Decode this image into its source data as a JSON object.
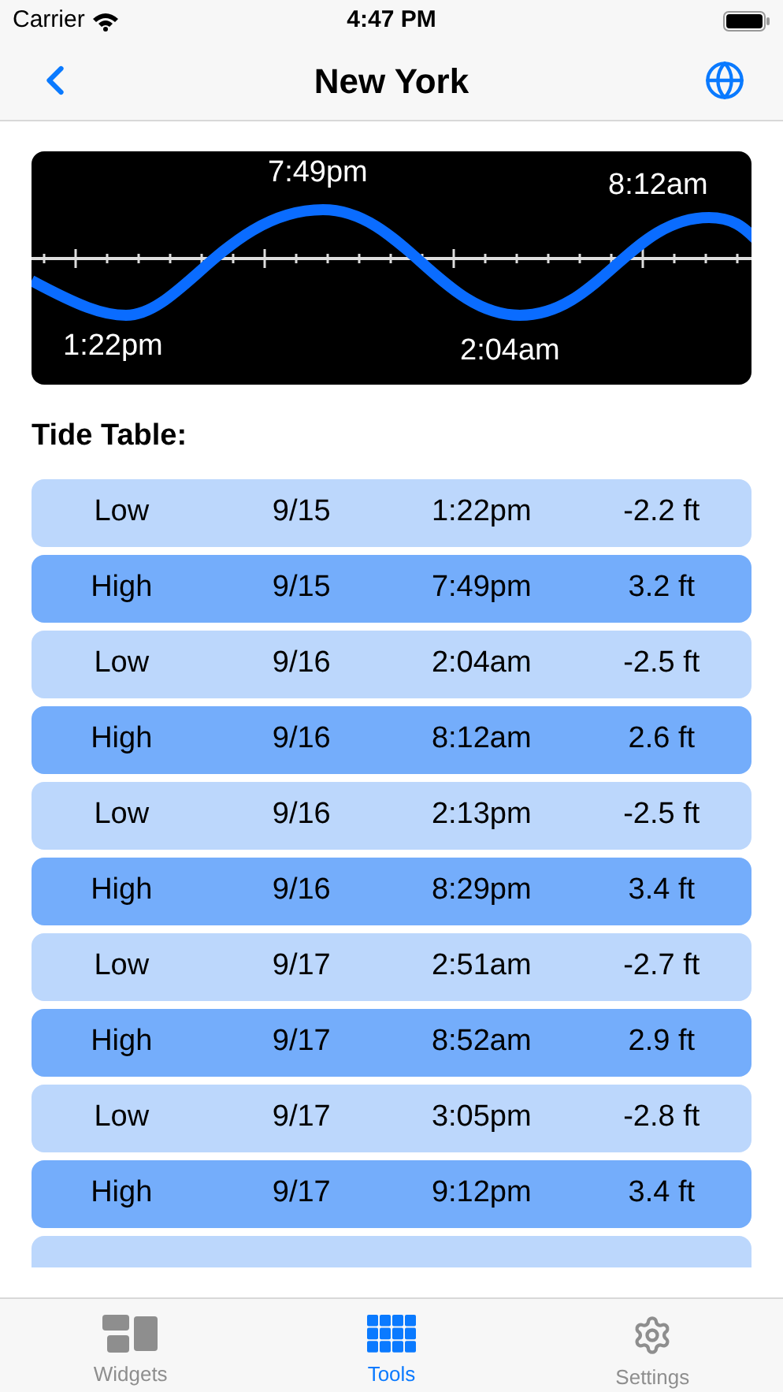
{
  "status_bar": {
    "carrier": "Carrier",
    "time": "4:47 PM"
  },
  "nav": {
    "title": "New York"
  },
  "tide_chart": {
    "labels": [
      {
        "text": "7:49pm",
        "kind": "high"
      },
      {
        "text": "8:12am",
        "kind": "high"
      },
      {
        "text": "1:22pm",
        "kind": "low"
      },
      {
        "text": "2:04am",
        "kind": "low"
      }
    ]
  },
  "section_title": "Tide Table:",
  "rows": [
    {
      "kind": "low",
      "type": "Low",
      "date": "9/15",
      "time": "1:22pm",
      "height": "-2.2 ft"
    },
    {
      "kind": "high",
      "type": "High",
      "date": "9/15",
      "time": "7:49pm",
      "height": "3.2 ft"
    },
    {
      "kind": "low",
      "type": "Low",
      "date": "9/16",
      "time": "2:04am",
      "height": "-2.5 ft"
    },
    {
      "kind": "high",
      "type": "High",
      "date": "9/16",
      "time": "8:12am",
      "height": "2.6 ft"
    },
    {
      "kind": "low",
      "type": "Low",
      "date": "9/16",
      "time": "2:13pm",
      "height": "-2.5 ft"
    },
    {
      "kind": "high",
      "type": "High",
      "date": "9/16",
      "time": "8:29pm",
      "height": "3.4 ft"
    },
    {
      "kind": "low",
      "type": "Low",
      "date": "9/17",
      "time": "2:51am",
      "height": "-2.7 ft"
    },
    {
      "kind": "high",
      "type": "High",
      "date": "9/17",
      "time": "8:52am",
      "height": "2.9 ft"
    },
    {
      "kind": "low",
      "type": "Low",
      "date": "9/17",
      "time": "3:05pm",
      "height": "-2.8 ft"
    },
    {
      "kind": "high",
      "type": "High",
      "date": "9/17",
      "time": "9:12pm",
      "height": "3.4 ft"
    },
    {
      "kind": "low"
    }
  ],
  "tab_bar": [
    {
      "kind": "widgets",
      "label": "Widgets",
      "selected": false
    },
    {
      "kind": "tools",
      "label": "Tools",
      "selected": true
    },
    {
      "kind": "settings",
      "label": "Settings",
      "selected": false
    }
  ]
}
